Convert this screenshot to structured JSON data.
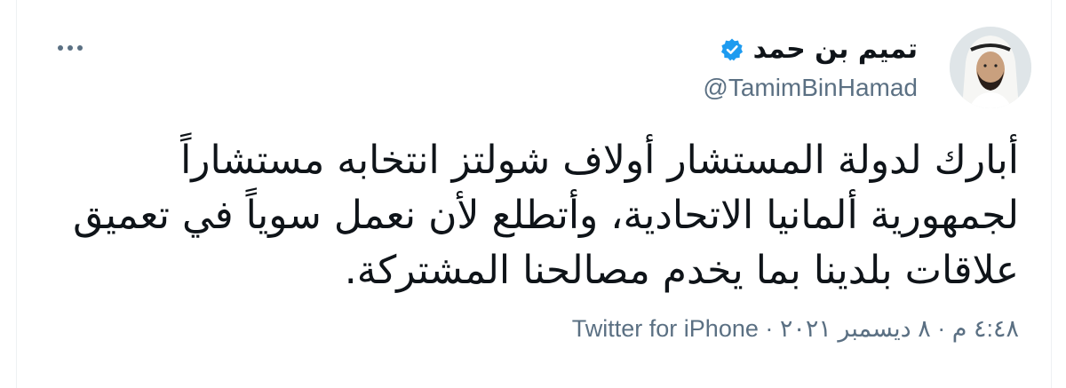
{
  "author": {
    "display_name": "تميم بن حمد",
    "handle": "@TamimBinHamad",
    "verified": true,
    "avatar_icon": "profile-photo"
  },
  "tweet": {
    "text_lines": [
      "أبارك لدولة المستشار أولاف شولتز انتخابه مستشاراً",
      "لجمهورية ألمانيا الاتحادية، وأتطلع لأن نعمل سوياً في تعميق",
      "علاقات بلدينا بما يخدم مصالحنا المشتركة."
    ],
    "time": "٤:٤٨ م",
    "separator": "·",
    "date": "٨ ديسمبر ٢٠٢١",
    "source": "Twitter for iPhone"
  },
  "menu": {
    "icon": "more-horizontal-icon"
  },
  "colors": {
    "verified": "#1d9bf0",
    "secondary_text": "#5b7083",
    "primary_text": "#0f1419"
  }
}
